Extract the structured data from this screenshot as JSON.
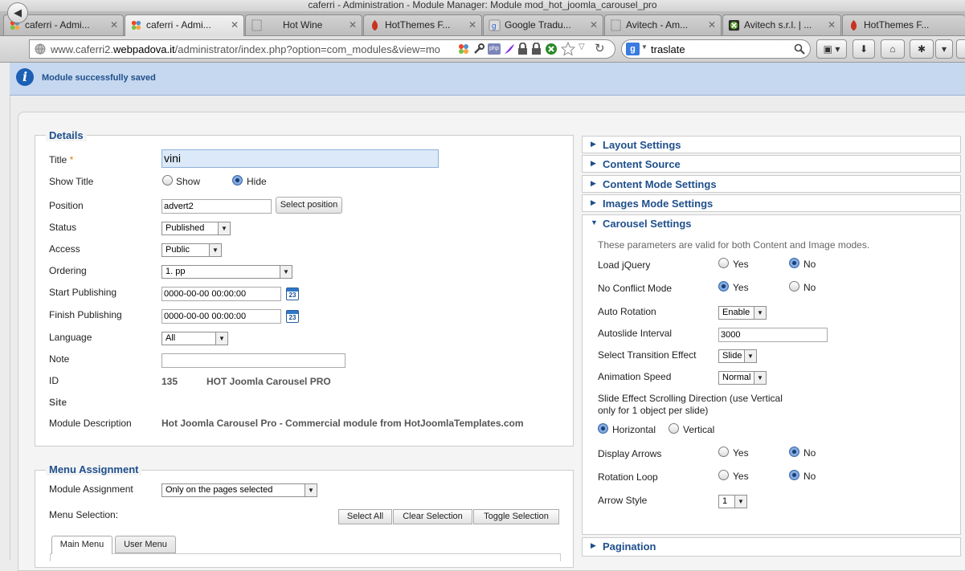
{
  "window": {
    "title": "caferri - Administration - Module Manager: Module mod_hot_joomla_carousel_pro"
  },
  "tabs": [
    {
      "label": "caferri - Admi...",
      "icon": "joomla-icon",
      "active": false
    },
    {
      "label": "caferri - Admi...",
      "icon": "joomla-icon",
      "active": true
    },
    {
      "label": "Hot Wine",
      "icon": "blank-page-icon",
      "active": false
    },
    {
      "label": "HotThemes F...",
      "icon": "hotthemes-icon",
      "active": false
    },
    {
      "label": "Google Tradu...",
      "icon": "google-translate-icon",
      "active": false
    },
    {
      "label": "Avitech - Am...",
      "icon": "blank-page-icon",
      "active": false
    },
    {
      "label": "Avitech s.r.l. | ...",
      "icon": "xbox-icon",
      "active": false
    },
    {
      "label": "HotThemes F...",
      "icon": "hotthemes-icon",
      "active": false
    }
  ],
  "navbar": {
    "url_prefix": "www.caferri2.",
    "url_host": "webpadova.it",
    "url_path": "/administrator/index.php?option=com_modules&view=mo",
    "search_value": "traslate"
  },
  "message": {
    "text": "Module successfully saved"
  },
  "details": {
    "legend": "Details",
    "title_label": "Title",
    "title_required": "*",
    "title_value": "vini",
    "show_title_label": "Show Title",
    "show_title_show": "Show",
    "show_title_hide": "Hide",
    "position_label": "Position",
    "position_value": "advert2",
    "select_position_button": "Select position",
    "status_label": "Status",
    "status_value": "Published",
    "access_label": "Access",
    "access_value": "Public",
    "ordering_label": "Ordering",
    "ordering_value": "1. pp",
    "start_publishing_label": "Start Publishing",
    "start_publishing_value": "0000-00-00 00:00:00",
    "finish_publishing_label": "Finish Publishing",
    "finish_publishing_value": "0000-00-00 00:00:00",
    "calendar_day": "23",
    "language_label": "Language",
    "language_value": "All",
    "note_label": "Note",
    "note_value": "",
    "id_label": "ID",
    "id_value": "135",
    "module_type": "HOT Joomla Carousel PRO",
    "site_label": "Site",
    "description_label": "Module Description",
    "description_value": "Hot Joomla Carousel Pro - Commercial module from HotJoomlaTemplates.com"
  },
  "menu_assignment": {
    "legend": "Menu Assignment",
    "assignment_label": "Module Assignment",
    "assignment_value": "Only on the pages selected",
    "selection_label": "Menu Selection:",
    "select_all": "Select All",
    "clear_selection": "Clear Selection",
    "toggle_selection": "Toggle Selection",
    "menu_tabs": [
      "Main Menu",
      "User Menu"
    ]
  },
  "panes": {
    "layout": "Layout Settings",
    "content_source": "Content Source",
    "content_mode": "Content Mode Settings",
    "images_mode": "Images Mode Settings",
    "carousel": "Carousel Settings",
    "pagination": "Pagination"
  },
  "carousel": {
    "description": "These parameters are valid for both Content and Image modes.",
    "load_jquery_label": "Load jQuery",
    "no_conflict_label": "No Conflict Mode",
    "auto_rotation_label": "Auto Rotation",
    "auto_rotation_value": "Enable",
    "autoslide_label": "Autoslide Interval",
    "autoslide_value": "3000",
    "transition_label": "Select Transition Effect",
    "transition_value": "Slide",
    "speed_label": "Animation Speed",
    "speed_value": "Normal",
    "direction_label_1": "Slide Effect Scrolling Direction (use Vertical",
    "direction_label_2": "only for 1 object per slide)",
    "horizontal": "Horizontal",
    "vertical": "Vertical",
    "display_arrows_label": "Display Arrows",
    "rotation_loop_label": "Rotation Loop",
    "arrow_style_label": "Arrow Style",
    "arrow_style_value": "1",
    "yes": "Yes",
    "no": "No",
    "selected": {
      "load_jquery": "No",
      "no_conflict": "Yes",
      "direction": "Horizontal",
      "display_arrows": "No",
      "rotation_loop": "No"
    }
  },
  "colors": {
    "accent": "#1f4f8c",
    "message_bg": "#c6d8ef",
    "title_input_bg": "#dbe9f8"
  }
}
